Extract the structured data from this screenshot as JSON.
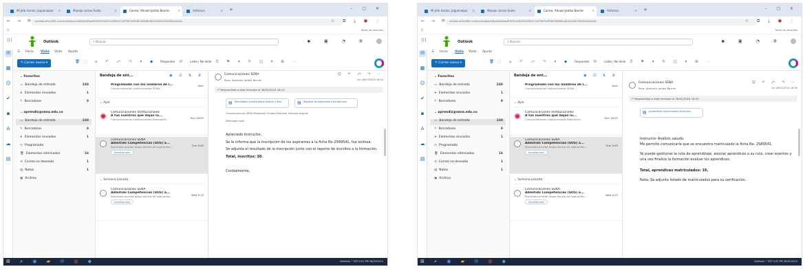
{
  "left": {
    "browser": {
      "tabs": [
        "Mi Jefa Aarian, Jaquenalpor",
        "Manejo correo Suelo",
        "Correo: Ahnael Jantas Barrier",
        "Anfomos"
      ],
      "url": "outlook.office365.com/mail/inbox/id/AAQkADAwATM3ZmYAZS1kZDlkLTQ2ZTAtYmM0NC00MzBmNjQ4ZGM1ZWYAEAAAAAA",
      "bookmarks_right": "Todos los favoritos"
    },
    "app": {
      "name": "Outlook",
      "search_placeholder": "Buscar"
    },
    "ribbon": {
      "tabs": [
        "Inicio",
        "Vista",
        "Vista",
        "Ayuda"
      ],
      "new_mail": "Correo nuevo",
      "reply_all": "Responder",
      "read_unread": "Leído / No leído"
    },
    "folders": {
      "favorites": "Favoritos",
      "fav_items": [
        {
          "label": "Bandeja de entrada",
          "count": "248"
        },
        {
          "label": "Elementos enviados",
          "count": "1"
        },
        {
          "label": "Borradores",
          "count": "8"
        }
      ],
      "account": "aprendiz@sena.edu.co",
      "items": [
        {
          "label": "Bandeja de entrada",
          "count": "248"
        },
        {
          "label": "Borradores",
          "count": "8"
        },
        {
          "label": "Elementos enviados",
          "count": "1"
        },
        {
          "label": "Programado",
          "count": ""
        },
        {
          "label": "Elementos eliminados",
          "count": "16"
        },
        {
          "label": "Correo no deseado",
          "count": "1"
        },
        {
          "label": "Notas",
          "count": "1"
        },
        {
          "label": "Archivo",
          "count": ""
        }
      ]
    },
    "messages": {
      "header": "Bandeja de ent...",
      "top": {
        "subject": "Programado con los nombres de l...",
        "time": "Ayer",
        "preview": "Comunicaciones institucionales SENA..."
      },
      "group1": "Ayer",
      "items": [
        {
          "sender": "Comunicaciones Institucionales",
          "subject": "A tus nuestros que dejan lu...",
          "time": "Sun 16:02",
          "preview": "Comunicaciones Institucionales Bienvenid..."
        },
        {
          "sender": "Comunicaciones SENA",
          "subject": "Admitido Competencias (SOS) a...",
          "time": "Sun 9:45",
          "preview": "Resultado prueba etapa lectiva de aspirantes...",
          "attachment": "Inscritos.xlsx"
        }
      ],
      "group2": "Semana pasada",
      "item3": {
        "sender": "Comunicaciones SENA",
        "subject": "Admitido Competencias (SOS) a...",
        "time": "Wed 9:15",
        "preview": "Resultado prueba etapa lectiva de aspirantes...",
        "attachment": "Inscritos.xlsx"
      }
    },
    "reading": {
      "sender": "Comunicaciones SENA",
      "to": "Para: Aprendiz Jantas Barrier",
      "date": "lun 26/02/2024 16:10",
      "banner": "Respondiste a este mensaje el 26/02/2024 16:10",
      "att1": "Resultados prueba etapa lectiva 4 Xlsx",
      "att2": "Registro de aspirantes inscritos.xlsx",
      "small1": "Comunicaciones SENA   Responder a todos   Reenviar mensaje original",
      "small2": "Descargar todo",
      "greeting": "Apreciado Instructor,",
      "p1": "Se le informa que la inscripción de los aspirantes a la ficha No 2589541, fue exitosa.",
      "p2": "Se adjunta el resultado de la inscripción junto con el reporte de inscritos a la formación.",
      "p3": "Total, inscritos: 30.",
      "closing": "Cordialmente,"
    },
    "taskbar": {
      "right": "Nublado  ^  ESP  4:41 PM  26/02/2024"
    }
  },
  "right": {
    "browser": {
      "tabs": [
        "Mi Jefa Aarian, Jaquenalpor",
        "Manejo correo Suelo",
        "Correo: Ahnael Jantas Barrier",
        "Anfomos"
      ],
      "url": "outlook.office365.com/mail/inbox/id/AAQkADAwATM3ZmYAZS1kZDlkLTQ2ZTAtYmM0NC00MzBmNjQ4ZGM1ZWYAEAAAAAB",
      "bookmarks_right": "Todos los favoritos"
    },
    "app": {
      "name": "Outlook",
      "search_placeholder": "Buscar"
    },
    "ribbon": {
      "tabs": [
        "Inicio",
        "Vista",
        "Vista",
        "Ayuda"
      ],
      "new_mail": "Correo nuevo",
      "reply_all": "Responder",
      "read_unread": "Leído / No leído"
    },
    "folders": {
      "favorites": "Favoritos",
      "fav_items": [
        {
          "label": "Bandeja de entrada",
          "count": "248"
        },
        {
          "label": "Elementos enviados",
          "count": "1"
        },
        {
          "label": "Borradores",
          "count": "8"
        }
      ],
      "account": "aprendiz@sena.edu.co",
      "items": [
        {
          "label": "Bandeja de entrada",
          "count": "248"
        },
        {
          "label": "Borradores",
          "count": "8"
        },
        {
          "label": "Elementos enviados",
          "count": "1"
        },
        {
          "label": "Programado",
          "count": ""
        },
        {
          "label": "Elementos eliminados",
          "count": "16"
        },
        {
          "label": "Correo no deseado",
          "count": "1"
        },
        {
          "label": "Notas",
          "count": "1"
        },
        {
          "label": "Archivo",
          "count": ""
        }
      ]
    },
    "messages": {
      "header": "Bandeja de ent...",
      "top": {
        "subject": "Programado con los nombres de l...",
        "time": "Ayer",
        "preview": "Comunicaciones institucionales SENA..."
      },
      "group1": "Ayer",
      "items": [
        {
          "sender": "Comunicaciones Institucionales",
          "subject": "A tus nuestros que dejan lu...",
          "time": "Sun 16:02",
          "preview": "Comunicaciones Institucionales Bienvenid..."
        },
        {
          "sender": "Comunicaciones SENA",
          "subject": "Admitido Competencias (SOS) a...",
          "time": "Sun 9:45",
          "preview": "Resultado prueba etapa lectiva de aspirantes...",
          "attachment": "Inscritos.xlsx"
        }
      ],
      "group2": "Semana pasada",
      "item3": {
        "sender": "Comunicaciones SENA",
        "subject": "Admitido Competencias (SOS) a...",
        "time": "Wed 9:15",
        "preview": "Resultado prueba etapa lectiva de aspirantes...",
        "attachment": "Inscritos.xlsx"
      }
    },
    "reading": {
      "sender": "Comunicaciones SENA",
      "to": "Para: Aprendiz Jantas Barrier",
      "date": "lun 26/02/2024 16:30",
      "banner": "Respondiste a este mensaje el 26/02/2024 16:30",
      "att1": "Aprendices matriculados ficha.xlsx",
      "greeting": "Instructor Análisis saludo,",
      "p1": "Me permito comunicarle que se encuentra matriculado la ficha No. 2589541.",
      "p2": "Ya puede gestionar la ruta de aprendizaje, asociar aprendices a su ruta, crear eventos y una vez finalice la formación evaluar los aprendices.",
      "p3": "Total, aprendices matriculados: 16.",
      "note": "Nota: Se adjunta listado de matriculados para su verificación."
    },
    "taskbar": {
      "right": "Nublado  ^  ESP  4:42 PM  26/02/2024"
    }
  },
  "colors": {
    "accent": "#0f6cbd",
    "taskbar": "#1a2740",
    "logo_green": "#39a900"
  }
}
